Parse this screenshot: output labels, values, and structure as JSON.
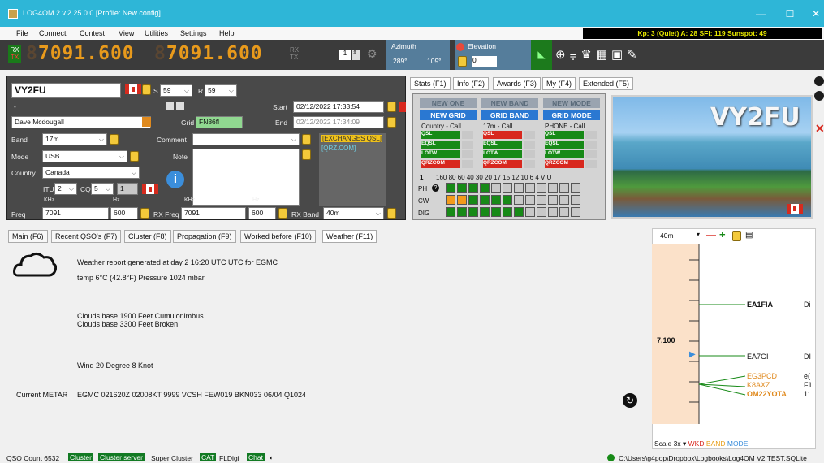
{
  "window": {
    "title": "LOG4OM 2 v.2.25.0.0 [Profile: New config]",
    "controls": [
      "—",
      "☐",
      "✕"
    ]
  },
  "menu": [
    "File",
    "Connect",
    "Contest",
    "View",
    "Utilities",
    "Settings",
    "Help"
  ],
  "kp_status": "Kp: 3 (Quiet) A: 28 SFI: 119 Sunspot: 49",
  "radio": {
    "rx_label": "RX",
    "tx_label": "TX",
    "vfo_a": {
      "dim": "8",
      "lit": "7091.600"
    },
    "vfo_b": {
      "dim": "8",
      "lit": "7091.600"
    },
    "vfo_b_rx": "RX",
    "vfo_b_tx": "TX",
    "radio_number": "1",
    "azimuth_label": "Azimuth",
    "azimuth_short": "289°",
    "azimuth_long": "109°",
    "elevation_label": "Elevation",
    "elevation_value": "0"
  },
  "qso": {
    "callsign": "VY2FU",
    "rst_s_label": "S",
    "rst_sent": "59",
    "rst_r_label": "R",
    "rst_rcvd": "59",
    "dash": "-",
    "start_label": "Start",
    "start": "02/12/2022 17:33:54",
    "end_label": "End",
    "end": "02/12/2022 17:34:09",
    "name": "Dave Mcdougall",
    "grid_label": "Grid",
    "grid": "FN86fl",
    "band_label": "Band",
    "band": "17m",
    "comment_label": "Comment",
    "comment": "",
    "mode_label": "Mode",
    "mode": "USB",
    "note_label": "Note",
    "country_label": "Country",
    "country": "Canada",
    "itu_label": "ITU",
    "itu": "2",
    "cq_label": "CQ",
    "cq": "5",
    "cont_num": "1",
    "khz_label": "KHz",
    "hz_label": "Hz",
    "freq_label": "Freq",
    "freq_khz": "7091",
    "freq_hz": "600",
    "rxfreq_label": "RX Freq",
    "rxfreq_khz": "7091",
    "rxfreq_hz": "600",
    "rxband_label": "RX Band",
    "rxband": "40m",
    "links": [
      "[EXCHANGES QSL]",
      "[QRZ.COM]"
    ]
  },
  "stats_tabs": [
    "Stats (F1)",
    "Info (F2)",
    "Awards (F3)",
    "My (F4)",
    "Extended (F5)"
  ],
  "stats": {
    "top_buttons": [
      "NEW ONE",
      "NEW BAND",
      "NEW MODE"
    ],
    "mid_buttons": [
      "NEW GRID",
      "GRID BAND",
      "GRID MODE"
    ],
    "col_titles": [
      "Country - Call",
      "17m - Call",
      "PHONE - Call"
    ],
    "rows": [
      "QSL",
      "EQSL",
      "LOTW",
      "QRZCOM"
    ],
    "band_header": "160 80 60 40 30 20 17 15 12 10 6 4 V U",
    "first_col": "1",
    "modes": [
      "PH",
      "CW",
      "DIG"
    ]
  },
  "card": {
    "callsign": "VY2FU"
  },
  "bottom_tabs": [
    "Main (F6)",
    "Recent QSO's (F7)",
    "Cluster (F8)",
    "Propagation (F9)",
    "Worked before (F10)",
    "Weather (F11)"
  ],
  "weather": {
    "report": "Weather report generated at day 2 16:20 UTC UTC for EGMC",
    "temp": "temp 6°C (42.8°F) Pressure 1024 mbar",
    "clouds1": "Clouds base 1900 Feet Cumulonimbus",
    "clouds2": "Clouds base 3300 Feet Broken",
    "wind": "Wind 20 Degree 8 Knot",
    "metar_label": "Current METAR",
    "metar": "EGMC 021620Z 02008KT 9999 VCSH FEW019 BKN033 06/04 Q1024"
  },
  "bandmap": {
    "band": "40m",
    "freq_label": "7,100",
    "spots": [
      {
        "call": "EA1FIA",
        "extra": "Di"
      },
      {
        "call": "EA7GI",
        "extra": "DI"
      },
      {
        "call": "EG3PCD",
        "extra": "e("
      },
      {
        "call": "K8AXZ",
        "extra": "F1"
      },
      {
        "call": "OM22YOTA",
        "extra": "1:"
      }
    ],
    "scale": "Scale 3x",
    "legend_wkd": "WKD",
    "legend_band": "BAND",
    "legend_mode": "MODE"
  },
  "statusbar": {
    "qso_count": "QSO Count  6532",
    "cluster": "Cluster",
    "cluster_server": "Cluster server",
    "super_cluster": "Super Cluster",
    "cat": "CAT",
    "fldigi": "FLDigi",
    "chat": "Chat",
    "path": "C:\\Users\\g4pop\\Dropbox\\Logbooks\\Log4OM V2 TEST.SQLite"
  },
  "colors": {
    "titlebar": "#2eb6d7",
    "accent_green": "#127a23",
    "vfo_lit": "#e89a1c"
  }
}
